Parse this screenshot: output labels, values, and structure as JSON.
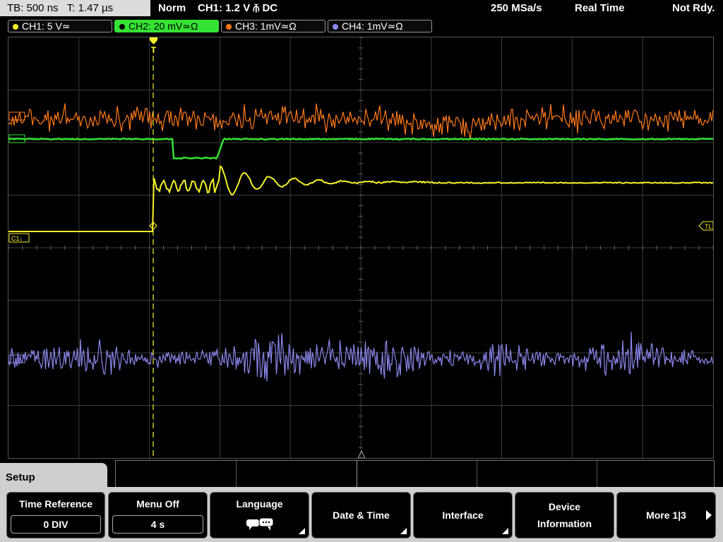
{
  "status_bar": {
    "timebase": "TB: 500 ns",
    "trigger_time": "T: 1.47 µs",
    "mode": "Norm",
    "trigger": "CH1: 1.2 V ⫚ DC",
    "sample_rate": "250 MSa/s",
    "acq_mode": "Real Time",
    "state": "Not Rdy."
  },
  "channels": [
    {
      "label": "CH1: 5 V≃",
      "color": "#f4f22a"
    },
    {
      "label": "CH2: 20 mV≃Ω",
      "color": "#35e334"
    },
    {
      "label": "CH3: 1mV≃Ω",
      "color": "#ff7a1a"
    },
    {
      "label": "CH4: 1mV≃Ω",
      "color": "#8c88ee"
    }
  ],
  "display": {
    "trigger_marker": "T",
    "ch1_marker": "C1↓",
    "trigger_level_marker": "TL",
    "colors": {
      "ch1": "#f4f22a",
      "ch2": "#35e334",
      "ch3": "#ff7a1a",
      "ch4": "#8c88ee",
      "grid": "#3c3c3c"
    }
  },
  "menu": {
    "title": "Setup",
    "softkeys": [
      {
        "title": "Time Reference",
        "value": "0 DIV"
      },
      {
        "title": "Menu Off",
        "value": "4 s"
      },
      {
        "title": "Language",
        "icon": "speech-bubble-icon"
      },
      {
        "title": "Date & Time"
      },
      {
        "title": "Interface"
      },
      {
        "title": "Device\nInformation"
      },
      {
        "title": "More 1|3",
        "icon": "arrow-right-icon"
      }
    ]
  }
}
